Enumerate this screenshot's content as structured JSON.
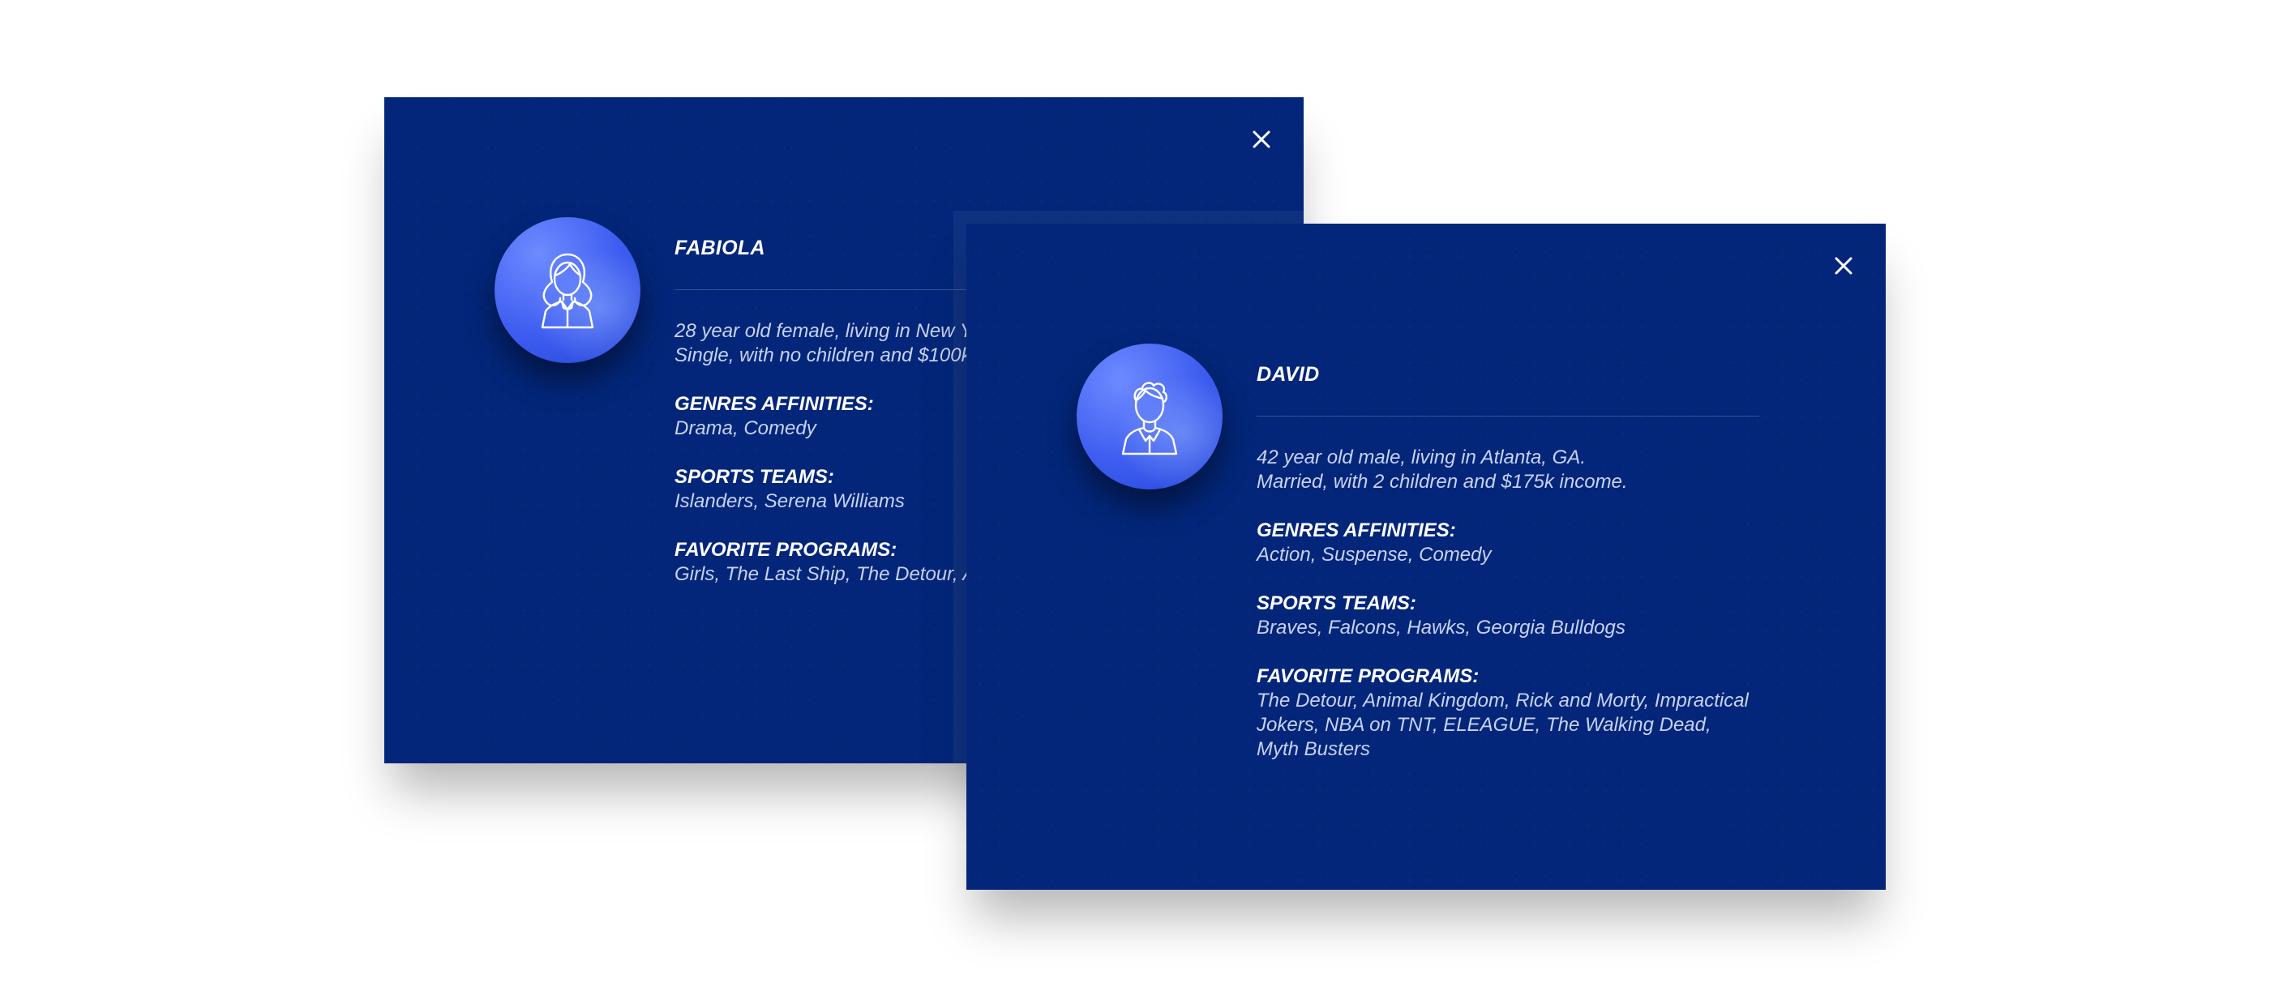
{
  "profiles": [
    {
      "name": "FABIOLA",
      "bio_lines": [
        "28 year old female, living in New Y",
        "Single, with no children and $100k"
      ],
      "genres_title": "GENRES AFFINITIES:",
      "genres_lines": [
        "Drama, Comedy"
      ],
      "sports_title": "SPORTS TEAMS:",
      "sports_lines": [
        "Islanders, Serena Williams"
      ],
      "programs_title": "FAVORITE PROGRAMS:",
      "programs_lines": [
        "Girls, The Last Ship, The Detour, A"
      ],
      "avatar_icon": "female-user-icon",
      "close_icon": "close-icon"
    },
    {
      "name": "DAVID",
      "bio_lines": [
        "42 year old male, living in Atlanta, GA.",
        "Married, with 2 children and $175k income."
      ],
      "genres_title": "GENRES AFFINITIES:",
      "genres_lines": [
        "Action, Suspense, Comedy"
      ],
      "sports_title": "SPORTS TEAMS:",
      "sports_lines": [
        "Braves, Falcons, Hawks, Georgia Bulldogs"
      ],
      "programs_title": "FAVORITE PROGRAMS:",
      "programs_lines": [
        "The Detour, Animal Kingdom, Rick and Morty, Impractical",
        "Jokers, NBA on TNT, ELEAGUE, The Walking Dead,",
        "Myth Busters"
      ],
      "avatar_icon": "male-user-icon",
      "close_icon": "close-icon"
    }
  ],
  "colors": {
    "card_background": "#03267a",
    "avatar_gradient_start": "#6e8bff",
    "avatar_gradient_end": "#2646d8",
    "text_primary": "#ffffff",
    "text_secondary": "#c8d2f2",
    "page_background": "#ffffff"
  }
}
